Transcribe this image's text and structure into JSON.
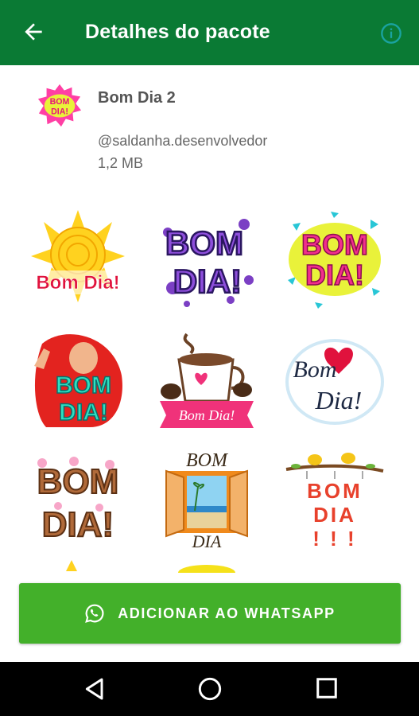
{
  "appbar": {
    "title": "Detalhes do pacote",
    "back_icon": "arrow-back-icon",
    "info_icon": "info-icon",
    "color": "#0a7a34"
  },
  "pack": {
    "name": "Bom Dia 2",
    "publisher": "@saldanha.desenvolvedor",
    "size": "1,2 MB",
    "icon_text": [
      "BOM",
      "DIA!"
    ]
  },
  "stickers": [
    {
      "id": "sun",
      "lines": [
        "Bom Dia!"
      ]
    },
    {
      "id": "purple-bubbles",
      "lines": [
        "BOM",
        "DIA!"
      ]
    },
    {
      "id": "pink-yellow",
      "lines": [
        "BOM",
        "DIA!"
      ]
    },
    {
      "id": "girl-redhair",
      "lines": [
        "BOM",
        "DIA!"
      ]
    },
    {
      "id": "coffee-cup",
      "lines": [
        "Bom Dia!"
      ]
    },
    {
      "id": "heart-script",
      "lines": [
        "Bom",
        "Dia!"
      ]
    },
    {
      "id": "donuts",
      "lines": [
        "BOM",
        "DIA!"
      ]
    },
    {
      "id": "window-beach",
      "lines": [
        "BOM",
        "DIA"
      ]
    },
    {
      "id": "birds-branch",
      "lines": [
        "BOM",
        "DIA",
        "! ! !"
      ]
    }
  ],
  "add_button": {
    "label": "ADICIONAR AO WHATSAPP",
    "icon": "whatsapp-icon",
    "color": "#43b02a"
  },
  "navbar": {
    "back_icon": "nav-back-icon",
    "home_icon": "nav-home-icon",
    "recents_icon": "nav-recents-icon"
  }
}
